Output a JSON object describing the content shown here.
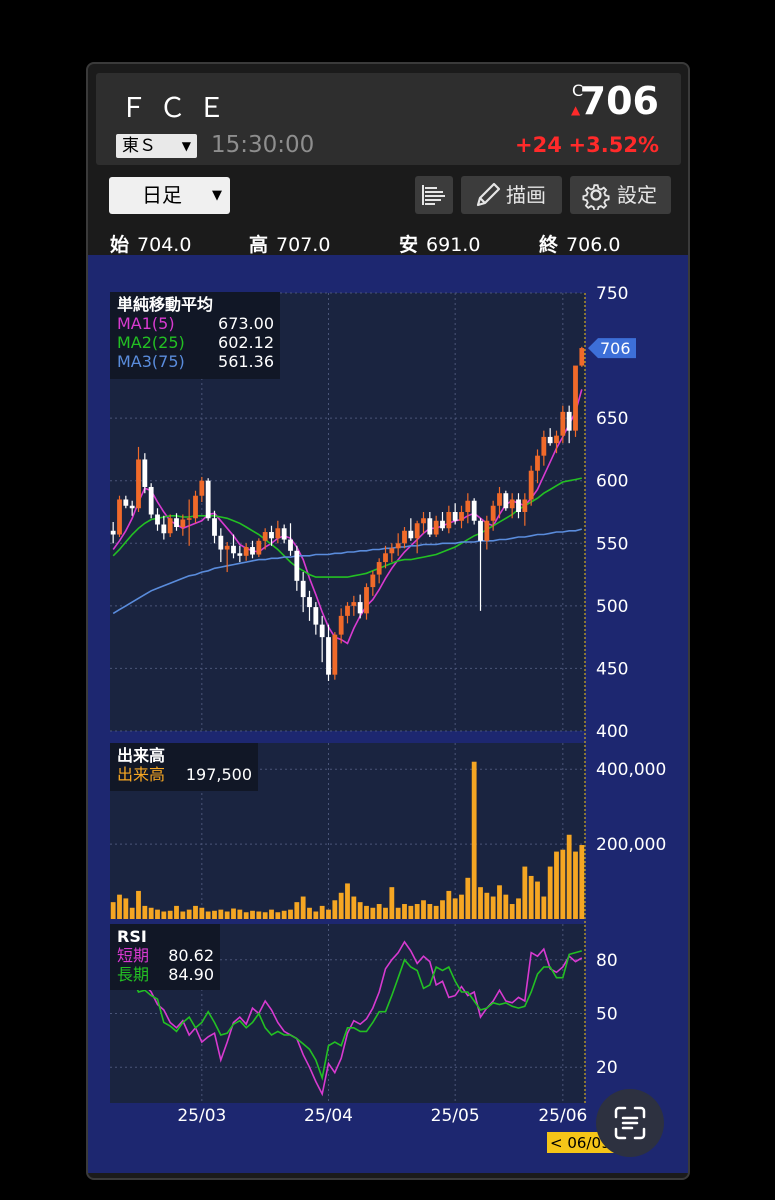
{
  "header": {
    "ticker": "ＦＣＥ",
    "market": "東Ｓ",
    "time": "15:30:00",
    "close_marker": "C",
    "price": "706",
    "change": "+24",
    "change_pct": "+3.52%"
  },
  "toolbar": {
    "period": "日足",
    "draw_label": "描画",
    "settings_label": "設定"
  },
  "ohlc": {
    "open_label": "始",
    "open": "704.0",
    "high_label": "高",
    "high": "707.0",
    "low_label": "安",
    "low": "691.0",
    "close_label": "終",
    "close": "706.0"
  },
  "colors": {
    "background": "#1d2770",
    "plot": "#1a2440",
    "up_candle": "#f06a2a",
    "down_candle": "#ffffff",
    "ma1": "#d83ad0",
    "ma2": "#23c023",
    "ma3": "#5a8cdc",
    "volume": "#f5a623",
    "rsi_short": "#d83ad0",
    "rsi_long": "#23c023",
    "price_tag": "#3d6fd8"
  },
  "chart_data": [
    {
      "type": "candlestick",
      "legend_title": "単純移動平均",
      "legend": [
        {
          "name": "MA1(5)",
          "value": "673.00"
        },
        {
          "name": "MA2(25)",
          "value": "602.12"
        },
        {
          "name": "MA3(75)",
          "value": "561.36"
        }
      ],
      "price_tag": "706",
      "y_ticks": [
        "750",
        "650",
        "600",
        "550",
        "500",
        "450",
        "400"
      ],
      "ylim": [
        400,
        750
      ],
      "x_ticks": [
        "25/03",
        "25/04",
        "25/05",
        "25/06"
      ],
      "cursor_date": "< 06/09",
      "ohlc": [
        [
          560,
          567,
          550,
          557
        ],
        [
          557,
          588,
          555,
          585
        ],
        [
          585,
          588,
          578,
          580
        ],
        [
          580,
          584,
          572,
          578
        ],
        [
          578,
          627,
          575,
          617
        ],
        [
          617,
          622,
          590,
          595
        ],
        [
          595,
          598,
          570,
          573
        ],
        [
          573,
          578,
          560,
          565
        ],
        [
          565,
          572,
          553,
          558
        ],
        [
          558,
          573,
          555,
          570
        ],
        [
          570,
          574,
          560,
          563
        ],
        [
          563,
          573,
          556,
          569
        ],
        [
          569,
          585,
          548,
          570
        ],
        [
          570,
          592,
          566,
          588
        ],
        [
          588,
          603,
          583,
          600
        ],
        [
          600,
          602,
          568,
          570
        ],
        [
          570,
          576,
          550,
          556
        ],
        [
          556,
          562,
          535,
          545
        ],
        [
          545,
          551,
          527,
          548
        ],
        [
          548,
          557,
          538,
          542
        ],
        [
          542,
          548,
          535,
          540
        ],
        [
          540,
          550,
          536,
          547
        ],
        [
          547,
          552,
          538,
          541
        ],
        [
          541,
          554,
          539,
          552
        ],
        [
          552,
          562,
          545,
          559
        ],
        [
          559,
          564,
          548,
          554
        ],
        [
          554,
          568,
          550,
          562
        ],
        [
          562,
          565,
          550,
          553
        ],
        [
          553,
          566,
          540,
          544
        ],
        [
          544,
          548,
          512,
          520
        ],
        [
          520,
          527,
          495,
          507
        ],
        [
          507,
          512,
          488,
          499
        ],
        [
          499,
          503,
          477,
          485
        ],
        [
          485,
          492,
          455,
          475
        ],
        [
          475,
          485,
          440,
          445
        ],
        [
          445,
          479,
          441,
          477
        ],
        [
          477,
          498,
          470,
          492
        ],
        [
          492,
          503,
          486,
          500
        ],
        [
          500,
          508,
          492,
          503
        ],
        [
          503,
          509,
          490,
          494
        ],
        [
          494,
          518,
          489,
          515
        ],
        [
          515,
          528,
          508,
          525
        ],
        [
          525,
          538,
          518,
          535
        ],
        [
          535,
          548,
          530,
          542
        ],
        [
          542,
          550,
          535,
          546
        ],
        [
          546,
          558,
          540,
          550
        ],
        [
          550,
          563,
          546,
          560
        ],
        [
          560,
          570,
          552,
          554
        ],
        [
          554,
          568,
          542,
          566
        ],
        [
          566,
          575,
          558,
          570
        ],
        [
          570,
          575,
          555,
          557
        ],
        [
          557,
          572,
          555,
          568
        ],
        [
          568,
          575,
          560,
          562
        ],
        [
          562,
          580,
          558,
          575
        ],
        [
          575,
          582,
          565,
          568
        ],
        [
          568,
          580,
          562,
          575
        ],
        [
          575,
          590,
          566,
          584
        ],
        [
          584,
          586,
          565,
          568
        ],
        [
          568,
          570,
          496,
          552
        ],
        [
          552,
          572,
          545,
          568
        ],
        [
          568,
          584,
          560,
          580
        ],
        [
          580,
          595,
          570,
          590
        ],
        [
          590,
          592,
          576,
          578
        ],
        [
          578,
          590,
          570,
          585
        ],
        [
          585,
          590,
          570,
          575
        ],
        [
          575,
          590,
          564,
          585
        ],
        [
          585,
          612,
          580,
          608
        ],
        [
          608,
          625,
          598,
          620
        ],
        [
          620,
          640,
          612,
          635
        ],
        [
          635,
          642,
          628,
          630
        ],
        [
          630,
          640,
          622,
          636
        ],
        [
          636,
          660,
          630,
          655
        ],
        [
          655,
          660,
          630,
          640
        ],
        [
          640,
          678,
          635,
          692
        ],
        [
          692,
          707,
          691,
          706
        ]
      ],
      "series": [
        {
          "name": "MA1(5)",
          "values": [
            545,
            552,
            560,
            570,
            583,
            594,
            592,
            583,
            575,
            568,
            565,
            562,
            564,
            566,
            568,
            573,
            574,
            568,
            562,
            556,
            549,
            546,
            544,
            543,
            547,
            550,
            554,
            556,
            554,
            547,
            537,
            522,
            509,
            495,
            483,
            475,
            473,
            470,
            482,
            492,
            500,
            505,
            513,
            522,
            530,
            537,
            543,
            548,
            553,
            558,
            562,
            562,
            564,
            566,
            568,
            569,
            572,
            574,
            570,
            566,
            564,
            573,
            581,
            584,
            582,
            580,
            586,
            593,
            604,
            615,
            626,
            635,
            645,
            655,
            673
          ]
        },
        {
          "name": "MA2(25)",
          "values": [
            540,
            545,
            551,
            557,
            562,
            566,
            569,
            570,
            571,
            572,
            572,
            571,
            571,
            572,
            572,
            572,
            572,
            571,
            570,
            568,
            566,
            563,
            560,
            557,
            553,
            549,
            545,
            540,
            535,
            531,
            528,
            525,
            523,
            523,
            523,
            523,
            523,
            523,
            524,
            525,
            526,
            528,
            530,
            532,
            534,
            536,
            537,
            537,
            538,
            539,
            540,
            541,
            543,
            545,
            547,
            550,
            553,
            556,
            558,
            561,
            564,
            567,
            570,
            573,
            577,
            580,
            583,
            586,
            590,
            593,
            596,
            599,
            600,
            601,
            602.12
          ]
        },
        {
          "name": "MA3(75)",
          "values": [
            494,
            497,
            500,
            503,
            506,
            509,
            512,
            514,
            516,
            518,
            520,
            522,
            524,
            525,
            527,
            528,
            530,
            531,
            532,
            533,
            534,
            535,
            536,
            537,
            537,
            538,
            538,
            539,
            539,
            540,
            540,
            540,
            541,
            541,
            541,
            542,
            542,
            543,
            543,
            544,
            544,
            545,
            545,
            546,
            546,
            547,
            547,
            548,
            548,
            549,
            549,
            549,
            550,
            550,
            550,
            551,
            551,
            551,
            552,
            552,
            552,
            553,
            553,
            554,
            555,
            555,
            556,
            557,
            557,
            558,
            559,
            559,
            560,
            560,
            561.36
          ]
        }
      ]
    },
    {
      "type": "bar",
      "legend_title": "出来高",
      "legend": [
        {
          "name": "出来高",
          "value": "197,500"
        }
      ],
      "y_ticks": [
        "400,000",
        "200,000"
      ],
      "ylim": [
        0,
        470000
      ],
      "values": [
        45000,
        65000,
        55000,
        30000,
        75000,
        35000,
        30000,
        25000,
        20000,
        22000,
        35000,
        20000,
        25000,
        35000,
        30000,
        20000,
        22000,
        25000,
        20000,
        28000,
        25000,
        18000,
        22000,
        20000,
        18000,
        25000,
        18000,
        22000,
        25000,
        45000,
        60000,
        30000,
        20000,
        35000,
        25000,
        50000,
        70000,
        95000,
        60000,
        45000,
        35000,
        30000,
        40000,
        30000,
        85000,
        30000,
        40000,
        35000,
        40000,
        50000,
        40000,
        35000,
        50000,
        75000,
        55000,
        65000,
        110000,
        420000,
        85000,
        70000,
        60000,
        90000,
        65000,
        40000,
        55000,
        140000,
        115000,
        100000,
        60000,
        140000,
        180000,
        185000,
        225000,
        180000,
        197500
      ]
    },
    {
      "type": "line",
      "legend_title": "RSI",
      "legend": [
        {
          "name": "短期",
          "value": "80.62"
        },
        {
          "name": "長期",
          "value": "84.90"
        }
      ],
      "y_ticks": [
        "80",
        "50",
        "20"
      ],
      "ylim": [
        0,
        100
      ],
      "series": [
        {
          "name": "短期",
          "values": [
            75,
            82,
            76,
            78,
            65,
            66,
            62,
            55,
            52,
            45,
            42,
            46,
            38,
            42,
            34,
            37,
            39,
            24,
            34,
            45,
            48,
            44,
            53,
            50,
            57,
            52,
            45,
            40,
            38,
            36,
            27,
            20,
            12,
            5,
            22,
            17,
            25,
            39,
            46,
            44,
            47,
            53,
            62,
            75,
            80,
            84,
            90,
            85,
            78,
            82,
            79,
            66,
            68,
            59,
            60,
            65,
            60,
            62,
            48,
            53,
            57,
            63,
            57,
            56,
            59,
            57,
            84,
            82,
            86,
            75,
            73,
            76,
            82,
            79,
            81
          ]
        },
        {
          "name": "長期",
          "values": [
            82,
            84,
            84,
            70,
            62,
            63,
            60,
            58,
            45,
            43,
            40,
            45,
            48,
            42,
            45,
            51,
            45,
            38,
            39,
            44,
            46,
            42,
            45,
            50,
            42,
            38,
            40,
            38,
            38,
            36,
            33,
            30,
            24,
            14,
            32,
            34,
            32,
            42,
            42,
            40,
            40,
            45,
            51,
            51,
            60,
            70,
            80,
            76,
            74,
            64,
            66,
            76,
            74,
            76,
            68,
            62,
            62,
            57,
            52,
            53,
            56,
            55,
            56,
            54,
            53,
            54,
            62,
            72,
            76,
            76,
            70,
            70,
            83,
            84,
            85
          ]
        }
      ]
    }
  ]
}
